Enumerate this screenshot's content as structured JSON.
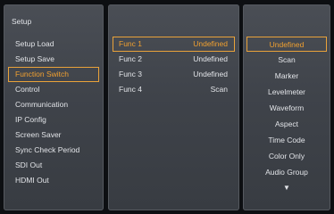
{
  "setup": {
    "title": "Setup",
    "items": [
      {
        "label": "Setup Load"
      },
      {
        "label": "Setup Save"
      },
      {
        "label": "Function Switch"
      },
      {
        "label": "Control"
      },
      {
        "label": "Communication"
      },
      {
        "label": "IP Config"
      },
      {
        "label": "Screen Saver"
      },
      {
        "label": "Sync Check Period"
      },
      {
        "label": "SDI Out"
      },
      {
        "label": "HDMI Out"
      }
    ],
    "selected": "Function Switch"
  },
  "functions": {
    "rows": [
      {
        "name": "Func 1",
        "value": "Undefined"
      },
      {
        "name": "Func 2",
        "value": "Undefined"
      },
      {
        "name": "Func 3",
        "value": "Undefined"
      },
      {
        "name": "Func 4",
        "value": "Scan"
      }
    ],
    "selected": "Func 1"
  },
  "options": {
    "items": [
      {
        "label": "Undefined"
      },
      {
        "label": "Scan"
      },
      {
        "label": "Marker"
      },
      {
        "label": "Levelmeter"
      },
      {
        "label": "Waveform"
      },
      {
        "label": "Aspect"
      },
      {
        "label": "Time Code"
      },
      {
        "label": "Color Only"
      },
      {
        "label": "Audio Group"
      }
    ],
    "more_indicator": "▼",
    "selected": "Undefined"
  },
  "colors": {
    "highlight": "#f0a030",
    "panel": "#43474d",
    "background": "#0d0f12"
  }
}
